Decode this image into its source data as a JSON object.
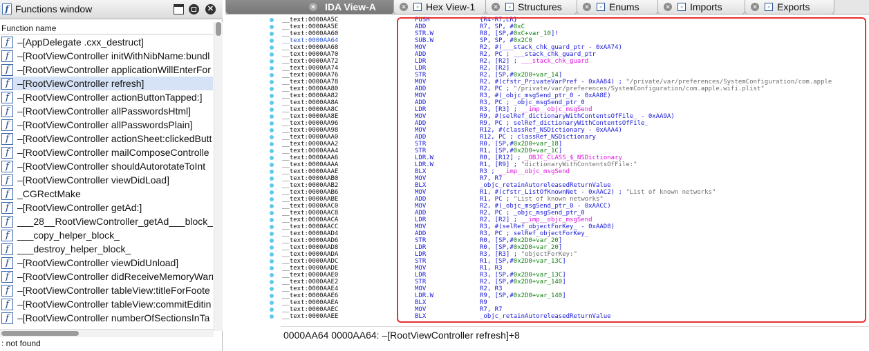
{
  "functions_window": {
    "title": "Functions window",
    "column_header": "Function name",
    "selected_index": 3,
    "items": [
      "–[AppDelegate .cxx_destruct]",
      "–[RootViewController initWithNibName:bundl",
      "–[RootViewController applicationWillEnterFor",
      "–[RootViewController refresh]",
      "–[RootViewController actionButtonTapped:]",
      "–[RootViewController allPasswordsHtml]",
      "–[RootViewController allPasswordsPlain]",
      "–[RootViewController actionSheet:clickedButt",
      "–[RootViewController mailComposeControlle",
      "–[RootViewController shouldAutorotateToInt",
      "–[RootViewController viewDidLoad]",
      "_CGRectMake",
      "–[RootViewController getAd:]",
      "___28__RootViewController_getAd___block_in",
      "___copy_helper_block_",
      "___destroy_helper_block_",
      "–[RootViewController viewDidUnload]",
      "–[RootViewController didReceiveMemoryWarn",
      "–[RootViewController tableView:titleForFoote",
      "–[RootViewController tableView:commitEditin",
      "–[RootViewController numberOfSectionsInTa"
    ],
    "status": ": not found"
  },
  "tabs": [
    {
      "label": "IDA View-A",
      "icon": "ida-view-icon",
      "active": true
    },
    {
      "label": "Hex View-1",
      "icon": "hex-view-icon",
      "active": false
    },
    {
      "label": "Structures",
      "icon": "structures-icon",
      "active": false
    },
    {
      "label": "Enums",
      "icon": "enums-icon",
      "active": false
    },
    {
      "label": "Imports",
      "icon": "imports-icon",
      "active": false
    },
    {
      "label": "Exports",
      "icon": "exports-icon",
      "active": false
    }
  ],
  "disassembly": [
    {
      "addr": "__text:0000AA5C",
      "mn": "PUSH",
      "ops": [
        [
          "t",
          "{R4-R7,LR}"
        ]
      ]
    },
    {
      "addr": "__text:0000AA5E",
      "mn": "ADD",
      "ops": [
        [
          "t",
          "R7, SP, #"
        ],
        [
          "num",
          "0xC"
        ]
      ]
    },
    {
      "addr": "__text:0000AA60",
      "mn": "STR.W",
      "ops": [
        [
          "t",
          "R8, [SP,#"
        ],
        [
          "num",
          "0xC+var_10"
        ],
        [
          "t",
          "]!"
        ]
      ]
    },
    {
      "addr": "__text:0000AA64",
      "mn": "SUB.W",
      "ops": [
        [
          "t",
          "SP, SP, #"
        ],
        [
          "num",
          "0x2C0"
        ]
      ],
      "hl": true
    },
    {
      "addr": "__text:0000AA68",
      "mn": "MOV",
      "ops": [
        [
          "t",
          "R2, #(___stack_chk_guard_ptr - 0xAA74)"
        ]
      ]
    },
    {
      "addr": "__text:0000AA70",
      "mn": "ADD",
      "ops": [
        [
          "t",
          "R2, PC ; ___stack_chk_guard_ptr"
        ]
      ]
    },
    {
      "addr": "__text:0000AA72",
      "mn": "LDR",
      "ops": [
        [
          "t",
          "R2, [R2] ; "
        ],
        [
          "nm",
          "___stack_chk_guard"
        ]
      ]
    },
    {
      "addr": "__text:0000AA74",
      "mn": "LDR",
      "ops": [
        [
          "t",
          "R2, [R2]"
        ]
      ]
    },
    {
      "addr": "__text:0000AA76",
      "mn": "STR",
      "ops": [
        [
          "t",
          "R2, [SP,#"
        ],
        [
          "num",
          "0x2D0+var_14"
        ],
        [
          "t",
          "]"
        ]
      ]
    },
    {
      "addr": "__text:0000AA78",
      "mn": "MOV",
      "ops": [
        [
          "t",
          "R2, #(cfstr_PrivateVarPref - 0xAA84) ; "
        ],
        [
          "cm",
          "\"/private/var/preferences/SystemConfiguration/com.apple"
        ]
      ]
    },
    {
      "addr": "__text:0000AA80",
      "mn": "ADD",
      "ops": [
        [
          "t",
          "R2, PC ; "
        ],
        [
          "cm",
          "\"/private/var/preferences/SystemConfiguration/com.apple.wifi.plist\""
        ]
      ]
    },
    {
      "addr": "__text:0000AA82",
      "mn": "MOV",
      "ops": [
        [
          "t",
          "R3, #(_objc_msgSend_ptr_0 - 0xAA8E)"
        ]
      ]
    },
    {
      "addr": "__text:0000AA8A",
      "mn": "ADD",
      "ops": [
        [
          "t",
          "R3, PC ; _objc_msgSend_ptr_0"
        ]
      ]
    },
    {
      "addr": "__text:0000AA8C",
      "mn": "LDR",
      "ops": [
        [
          "t",
          "R3, [R3] ; "
        ],
        [
          "nm",
          "__imp__objc_msgSend"
        ]
      ]
    },
    {
      "addr": "__text:0000AA8E",
      "mn": "MOV",
      "ops": [
        [
          "t",
          "R9, #(selRef_dictionaryWithContentsOfFile_ - 0xAA9A)"
        ]
      ]
    },
    {
      "addr": "__text:0000AA96",
      "mn": "ADD",
      "ops": [
        [
          "t",
          "R9, PC ; selRef_dictionaryWithContentsOfFile_"
        ]
      ]
    },
    {
      "addr": "__text:0000AA98",
      "mn": "MOV",
      "ops": [
        [
          "t",
          "R12, #(classRef_NSDictionary - 0xAAA4)"
        ]
      ]
    },
    {
      "addr": "__text:0000AAA0",
      "mn": "ADD",
      "ops": [
        [
          "t",
          "R12, PC ; classRef_NSDictionary"
        ]
      ]
    },
    {
      "addr": "__text:0000AAA2",
      "mn": "STR",
      "ops": [
        [
          "t",
          "R0, [SP,#"
        ],
        [
          "num",
          "0x2D0+var_18"
        ],
        [
          "t",
          "]"
        ]
      ]
    },
    {
      "addr": "__text:0000AAA4",
      "mn": "STR",
      "ops": [
        [
          "t",
          "R1, [SP,#"
        ],
        [
          "num",
          "0x2D0+var_1C"
        ],
        [
          "t",
          "]"
        ]
      ]
    },
    {
      "addr": "__text:0000AAA6",
      "mn": "LDR.W",
      "ops": [
        [
          "t",
          "R0, [R12] ; "
        ],
        [
          "nm",
          "_OBJC_CLASS_$_NSDictionary"
        ]
      ]
    },
    {
      "addr": "__text:0000AAAA",
      "mn": "LDR.W",
      "ops": [
        [
          "t",
          "R1, [R9] ; "
        ],
        [
          "cm",
          "\"dictionaryWithContentsOfFile:\""
        ]
      ]
    },
    {
      "addr": "__text:0000AAAE",
      "mn": "BLX",
      "ops": [
        [
          "t",
          "R3 ; "
        ],
        [
          "nm",
          "__imp__objc_msgSend"
        ]
      ]
    },
    {
      "addr": "__text:0000AAB0",
      "mn": "MOV",
      "ops": [
        [
          "t",
          "R7, R7"
        ]
      ]
    },
    {
      "addr": "__text:0000AAB2",
      "mn": "BLX",
      "ops": [
        [
          "t",
          "_objc_retainAutoreleasedReturnValue"
        ]
      ]
    },
    {
      "addr": "__text:0000AAB6",
      "mn": "MOV",
      "ops": [
        [
          "t",
          "R1, #(cfstr_ListOfKnownNet - 0xAAC2) ; "
        ],
        [
          "cm",
          "\"List of known networks\""
        ]
      ]
    },
    {
      "addr": "__text:0000AABE",
      "mn": "ADD",
      "ops": [
        [
          "t",
          "R1, PC ; "
        ],
        [
          "cm",
          "\"List of known networks\""
        ]
      ]
    },
    {
      "addr": "__text:0000AAC0",
      "mn": "MOV",
      "ops": [
        [
          "t",
          "R2, #(_objc_msgSend_ptr_0 - 0xAACC)"
        ]
      ]
    },
    {
      "addr": "__text:0000AAC8",
      "mn": "ADD",
      "ops": [
        [
          "t",
          "R2, PC ; _objc_msgSend_ptr_0"
        ]
      ]
    },
    {
      "addr": "__text:0000AACA",
      "mn": "LDR",
      "ops": [
        [
          "t",
          "R2, [R2] ; "
        ],
        [
          "nm",
          "__imp__objc_msgSend"
        ]
      ]
    },
    {
      "addr": "__text:0000AACC",
      "mn": "MOV",
      "ops": [
        [
          "t",
          "R3, #(selRef_objectForKey_ - 0xAAD8)"
        ]
      ]
    },
    {
      "addr": "__text:0000AAD4",
      "mn": "ADD",
      "ops": [
        [
          "t",
          "R3, PC ; selRef_objectForKey_"
        ]
      ]
    },
    {
      "addr": "__text:0000AAD6",
      "mn": "STR",
      "ops": [
        [
          "t",
          "R0, [SP,#"
        ],
        [
          "num",
          "0x2D0+var_20"
        ],
        [
          "t",
          "]"
        ]
      ]
    },
    {
      "addr": "__text:0000AAD8",
      "mn": "LDR",
      "ops": [
        [
          "t",
          "R0, [SP,#"
        ],
        [
          "num",
          "0x2D0+var_20"
        ],
        [
          "t",
          "]"
        ]
      ]
    },
    {
      "addr": "__text:0000AADA",
      "mn": "LDR",
      "ops": [
        [
          "t",
          "R3, [R3] ; "
        ],
        [
          "cm",
          "\"objectForKey:\""
        ]
      ]
    },
    {
      "addr": "__text:0000AADC",
      "mn": "STR",
      "ops": [
        [
          "t",
          "R1, [SP,#"
        ],
        [
          "num",
          "0x2D0+var_13C"
        ],
        [
          "t",
          "]"
        ]
      ]
    },
    {
      "addr": "__text:0000AADE",
      "mn": "MOV",
      "ops": [
        [
          "t",
          "R1, R3"
        ]
      ]
    },
    {
      "addr": "__text:0000AAE0",
      "mn": "LDR",
      "ops": [
        [
          "t",
          "R3, [SP,#"
        ],
        [
          "num",
          "0x2D0+var_13C"
        ],
        [
          "t",
          "]"
        ]
      ]
    },
    {
      "addr": "__text:0000AAE2",
      "mn": "STR",
      "ops": [
        [
          "t",
          "R2, [SP,#"
        ],
        [
          "num",
          "0x2D0+var_140"
        ],
        [
          "t",
          "]"
        ]
      ]
    },
    {
      "addr": "__text:0000AAE4",
      "mn": "MOV",
      "ops": [
        [
          "t",
          "R2, R3"
        ]
      ]
    },
    {
      "addr": "__text:0000AAE6",
      "mn": "LDR.W",
      "ops": [
        [
          "t",
          "R9, [SP,#"
        ],
        [
          "num",
          "0x2D0+var_140"
        ],
        [
          "t",
          "]"
        ]
      ]
    },
    {
      "addr": "__text:0000AAEA",
      "mn": "BLX",
      "ops": [
        [
          "t",
          "R9"
        ]
      ]
    },
    {
      "addr": "__text:0000AAEC",
      "mn": "MOV",
      "ops": [
        [
          "t",
          "R7, R7"
        ]
      ]
    },
    {
      "addr": "__text:0000AAEE",
      "mn": "BLX",
      "ops": [
        [
          "t",
          "_objc_retainAutoreleasedReturnValue"
        ]
      ]
    }
  ],
  "ida_status": "0000AA64  0000AA64: –[RootViewController refresh]+8"
}
